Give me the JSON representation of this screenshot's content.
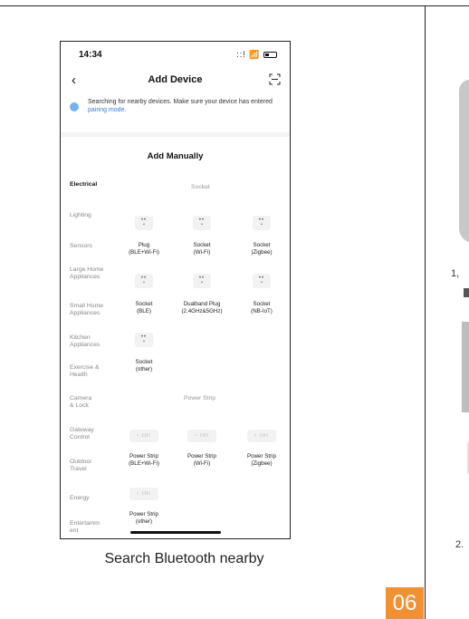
{
  "phone": {
    "status": {
      "time": "14:34",
      "signal": "::!"
    },
    "nav": {
      "title": "Add Device"
    },
    "banner": {
      "text": "Searching for nearby devices. Make sure your device has entered",
      "link": "pairing mode."
    },
    "add_manually": "Add Manually",
    "categories": [
      {
        "label": "Electrical",
        "active": true
      },
      {
        "label": "Lighting"
      },
      {
        "label": "Sensors"
      },
      {
        "label": "Large Home Appliances"
      },
      {
        "label": "Small Home Appliances"
      },
      {
        "label": "Kitchen Appliances"
      },
      {
        "label": "Exercise & Health"
      },
      {
        "label": "Camera & Lock"
      },
      {
        "label": "Gateway Control"
      },
      {
        "label": "Outdoor Travel"
      },
      {
        "label": "Energy"
      },
      {
        "label": "Entertainm ent"
      }
    ],
    "sections": {
      "socket": "Socket",
      "power_strip": "Power Strip"
    },
    "socket_devices": [
      {
        "name": "Plug",
        "sub": "(BLE+Wi-Fi)"
      },
      {
        "name": "Socket",
        "sub": "(Wi-Fi)"
      },
      {
        "name": "Socket",
        "sub": "(Zigbee)"
      },
      {
        "name": "Socket",
        "sub": "(BLE)"
      },
      {
        "name": "Dualband Plug",
        "sub": "(2.4GHz&5GHz)"
      },
      {
        "name": "Socket",
        "sub": "(NB-IoT)"
      },
      {
        "name": "Socket",
        "sub": "(other)"
      }
    ],
    "strip_devices": [
      {
        "name": "Power Strip",
        "sub": "(BLE+Wi-Fi)"
      },
      {
        "name": "Power Strip",
        "sub": "(Wi-Fi)"
      },
      {
        "name": "Power Strip",
        "sub": "(Zigbee)"
      },
      {
        "name": "Power Strip",
        "sub": "(other)"
      }
    ]
  },
  "caption": "Search Bluetooth nearby",
  "page_number": "06",
  "right": {
    "step1": "1,",
    "step2": "2."
  },
  "colors": {
    "accent": "#f29131",
    "link": "#2e7de1"
  }
}
